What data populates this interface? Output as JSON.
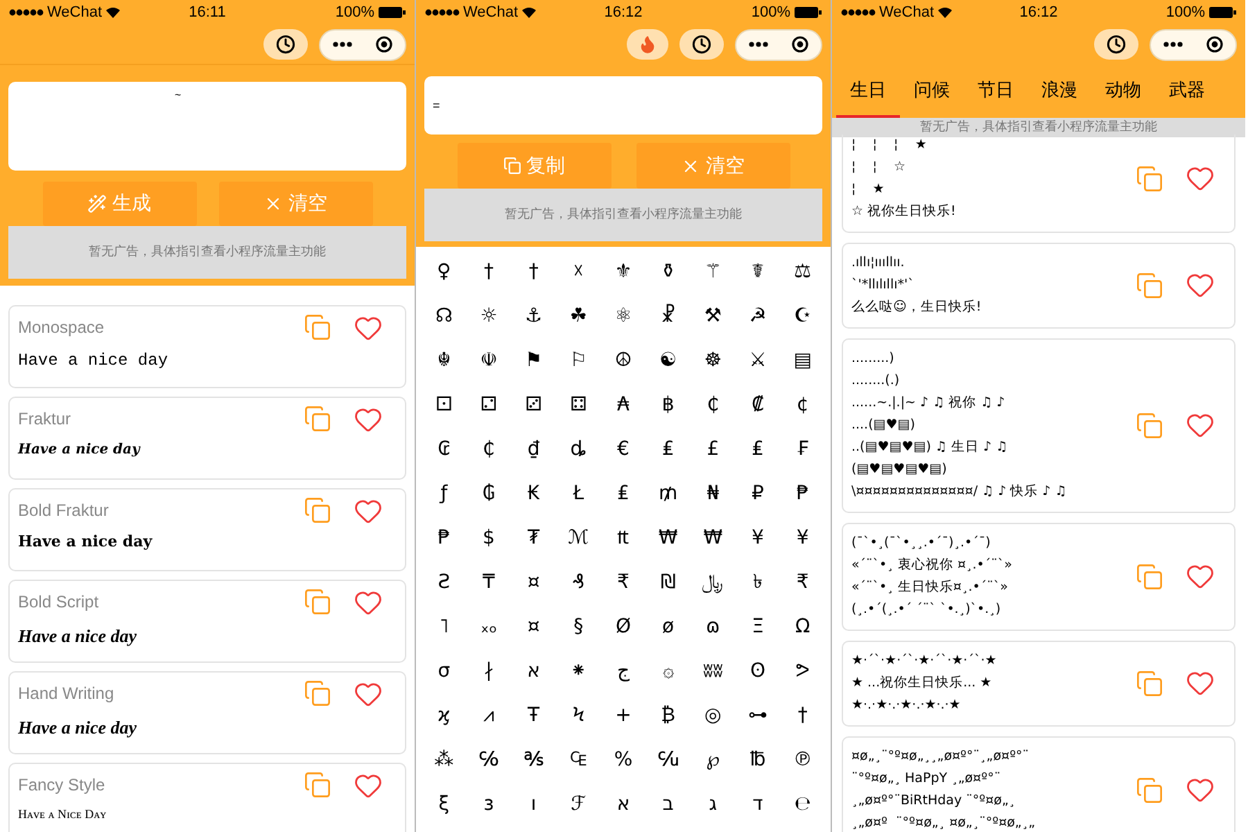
{
  "font_screen": {
    "status_bar": {
      "carrier": "WeChat",
      "time": "16:11",
      "battery": "100%"
    },
    "input": {
      "value": "~"
    },
    "buttons": [
      "生成",
      "清空"
    ],
    "ad": "暂无广告，具体指引查看小程序流量主功能",
    "cards": [
      {
        "kind": "mono",
        "title": "Monospace",
        "sample": "Have a nice day"
      },
      {
        "kind": "fraktur",
        "title": "Fraktur",
        "sample": "Have a nice day"
      },
      {
        "kind": "bold-fraktur",
        "title": "Bold Fraktur",
        "sample": "Have a nice day"
      },
      {
        "kind": "script",
        "title": "Bold Script",
        "sample": "Have a nice day"
      },
      {
        "kind": "script",
        "title": "Hand Writing",
        "sample": "Have a nice day"
      },
      {
        "kind": "smallcaps",
        "title": "Fancy Style",
        "sample": "Hᴀᴠᴇ ᴀ Nɪᴄᴇ Dᴀʏ"
      }
    ]
  },
  "symbol_screen": {
    "status_bar": {
      "carrier": "WeChat",
      "time": "16:12",
      "battery": "100%"
    },
    "input": {
      "value": "="
    },
    "buttons": [
      {
        "kind": "copy",
        "label": "复制"
      },
      {
        "kind": "clear",
        "label": "清空"
      }
    ],
    "ad": "暂无广告，具体指引查看小程序流量主功能",
    "symbols": [
      "♀",
      "†",
      "†",
      "☓",
      "⚜",
      "⚱",
      "⚚",
      "☤",
      "⚖",
      "☊",
      "☼",
      "⚓",
      "☘",
      "⚛",
      "☧",
      "⚒",
      "☭",
      "☪",
      "☬",
      "☫",
      "⚑",
      "⚐",
      "☮",
      "☯",
      "☸",
      "⚔",
      "▤",
      "⚀",
      "⚁",
      "⚂",
      "⚃",
      "₳",
      "฿",
      "₵",
      "₡",
      "¢",
      "₢",
      "₵",
      "₫",
      "ȡ",
      "€",
      "₤",
      "£",
      "₤",
      "₣",
      "ƒ",
      "₲",
      "₭",
      "Ł",
      "₤",
      "₥",
      "₦",
      "₽",
      "₱",
      "₱",
      "$",
      "₮",
      "ℳ",
      "₶",
      "₩",
      "₩",
      "¥",
      "¥",
      "Ƨ",
      "₸",
      "¤",
      "₰",
      "₹",
      "₪",
      "﷼",
      "৳",
      "₹",
      "˥",
      "ₓₒ",
      "¤",
      "§",
      "Ø",
      "ø",
      "ɷ",
      "Ξ",
      "Ω",
      "σ",
      "∤",
      "א",
      "⁕",
      "ج",
      "۞",
      "ʬʬ",
      "ʘ",
      "ᕗ",
      "ϗ",
      "⩘",
      "Ŧ",
      "Ϟ",
      "+",
      "₿",
      "◎",
      "⊶",
      "†",
      "⁂",
      "℅",
      "℁",
      "₠",
      "%",
      "℆",
      "℘",
      "℔",
      "℗",
      "ξ",
      "ɜ",
      "ו",
      "ℱ",
      "א",
      "ב",
      "ג",
      "ד",
      "℮"
    ]
  },
  "message_screen": {
    "status_bar": {
      "carrier": "WeChat",
      "time": "16:12",
      "battery": "100%"
    },
    "tabs": [
      {
        "label": "生日",
        "selected": true
      },
      {
        "label": "问候",
        "selected": false
      },
      {
        "label": "节日",
        "selected": false
      },
      {
        "label": "浪漫",
        "selected": false
      },
      {
        "label": "动物",
        "selected": false
      },
      {
        "label": "武器",
        "selected": false
      }
    ],
    "ad": "暂无广告，具体指引查看小程序流量主功能",
    "cards": [
      {
        "lines": [
          "¦    ¦    ¦    ★",
          "¦    ¦    ☆",
          "¦    ★",
          "☆ 祝你生日快乐!"
        ]
      },
      {
        "lines": [
          ".ıllı¦ıııllıı.",
          "`'*llılıllı*'`",
          "么么哒☺，生日快乐!"
        ]
      },
      {
        "lines": [
          ".........)",
          "........(.)",
          "......~.|.|~ ♪ ♫ 祝你 ♫ ♪",
          "....(▤♥▤)",
          "..(▤♥▤♥▤) ♫ 生日 ♪ ♫",
          "(▤♥▤♥▤♥▤)",
          "\\¤¤¤¤¤¤¤¤¤¤¤¤¤¤/ ♫ ♪ 快乐 ♪ ♫"
        ]
      },
      {
        "lines": [
          "(¯`•¸(¯`•¸¸.•´¯)¸.•´¯)",
          "«´¨`•¸ 衷心祝你 ¤¸.•´¨`»",
          "«´¨`•¸ 生日快乐¤¸.•´¨`»",
          "(¸.•´(¸.•´ ´¨` `•.¸)`•.¸)"
        ]
      },
      {
        "lines": [
          "★·´`·★·´`·★·´`·★·´`·★",
          "★ ...祝你生日快乐... ★",
          "★·.·★·.·★·.·★·.·★"
        ]
      },
      {
        "lines": [
          "¤ø„¸¨°º¤ø„¸¸„ø¤º°¨¸„ø¤º°¨",
          "¨°º¤ø„¸ HaPpY ¸„ø¤º°¨",
          "¸„ø¤º°¨BiRtHday ¨°º¤ø„¸",
          "¸„ø¤º  ¨°º¤ø„¸ ¤ø„¸¨°º¤ø„¸„"
        ]
      }
    ]
  }
}
